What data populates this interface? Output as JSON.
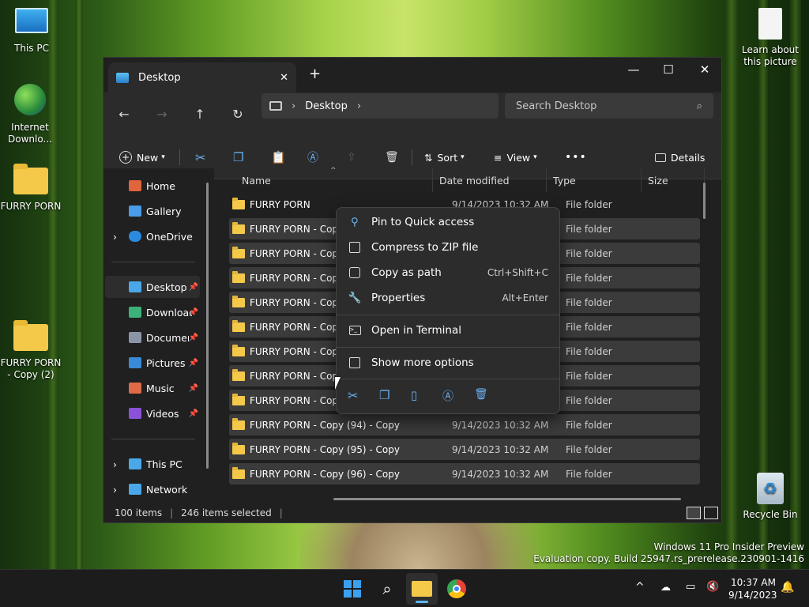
{
  "desktop": {
    "icons": [
      {
        "label": "This PC"
      },
      {
        "label": "Internet Downlo..."
      },
      {
        "label": "FURRY PORN"
      },
      {
        "label": "FURRY PORN - Copy (2)"
      },
      {
        "label": "Learn about this picture"
      },
      {
        "label": "Recycle Bin"
      }
    ],
    "watermark_line1": "Windows 11 Pro Insider Preview",
    "watermark_line2": "Evaluation copy. Build 25947.rs_prerelease.230901-1416"
  },
  "window": {
    "tab_title": "Desktop",
    "new_tab": "+",
    "minimize": "—",
    "maximize": "☐",
    "close": "✕",
    "address": {
      "segments": [
        "Desktop"
      ]
    },
    "search": {
      "placeholder": "Search Desktop"
    },
    "commands": {
      "new": "New",
      "sort": "Sort",
      "view": "View",
      "more": "•••",
      "details": "Details"
    }
  },
  "sidebar": {
    "items": [
      {
        "label": "Home",
        "pinned": false,
        "color": "#e0643c"
      },
      {
        "label": "Gallery",
        "pinned": false,
        "color": "#4a9be8"
      },
      {
        "label": "OneDrive",
        "pinned": false,
        "color": "#2a8ae0"
      },
      {
        "label": "Desktop",
        "pinned": true,
        "color": "#4aa8e8"
      },
      {
        "label": "Downloads",
        "pinned": true,
        "color": "#3cb27a"
      },
      {
        "label": "Documents",
        "pinned": true,
        "color": "#8a96a8"
      },
      {
        "label": "Pictures",
        "pinned": true,
        "color": "#3a8ad8"
      },
      {
        "label": "Music",
        "pinned": true,
        "color": "#e06a48"
      },
      {
        "label": "Videos",
        "pinned": true,
        "color": "#8a52d8"
      },
      {
        "label": "This PC",
        "pinned": false,
        "color": "#4aa8e8"
      },
      {
        "label": "Network",
        "pinned": false,
        "color": "#4aa8e8"
      }
    ]
  },
  "files": {
    "columns": [
      "Name",
      "Date modified",
      "Type",
      "Size"
    ],
    "rows": [
      {
        "name": "FURRY PORN",
        "date": "9/14/2023 10:32 AM",
        "type": "File folder",
        "selected": false
      },
      {
        "name": "FURRY PORN - Copy",
        "date": "",
        "type": "File folder",
        "selected": true
      },
      {
        "name": "FURRY PORN - Copy",
        "date": "",
        "type": "File folder",
        "selected": true
      },
      {
        "name": "FURRY PORN - Copy",
        "date": "",
        "type": "File folder",
        "selected": true
      },
      {
        "name": "FURRY PORN - Copy",
        "date": "",
        "type": "File folder",
        "selected": true
      },
      {
        "name": "FURRY PORN - Copy",
        "date": "",
        "type": "File folder",
        "selected": true
      },
      {
        "name": "FURRY PORN - Copy",
        "date": "",
        "type": "File folder",
        "selected": true
      },
      {
        "name": "FURRY PORN - Copy",
        "date": "",
        "type": "File folder",
        "selected": true
      },
      {
        "name": "FURRY PORN - Copy",
        "date": "",
        "type": "File folder",
        "selected": true
      },
      {
        "name": "FURRY PORN - Copy (94) - Copy",
        "date": "9/14/2023 10:32 AM",
        "type": "File folder",
        "selected": true
      },
      {
        "name": "FURRY PORN - Copy (95) - Copy",
        "date": "9/14/2023 10:32 AM",
        "type": "File folder",
        "selected": true
      },
      {
        "name": "FURRY PORN - Copy (96) - Copy",
        "date": "9/14/2023 10:32 AM",
        "type": "File folder",
        "selected": true
      }
    ]
  },
  "status": {
    "items": "100 items",
    "selected": "246 items selected"
  },
  "context_menu": {
    "items": [
      {
        "label": "Pin to Quick access",
        "accel": ""
      },
      {
        "label": "Compress to ZIP file",
        "accel": ""
      },
      {
        "label": "Copy as path",
        "accel": "Ctrl+Shift+C"
      },
      {
        "label": "Properties",
        "accel": "Alt+Enter"
      },
      {
        "label": "Open in Terminal",
        "accel": ""
      },
      {
        "label": "Show more options",
        "accel": ""
      }
    ]
  },
  "taskbar": {
    "time": "10:37 AM",
    "date": "9/14/2023"
  }
}
